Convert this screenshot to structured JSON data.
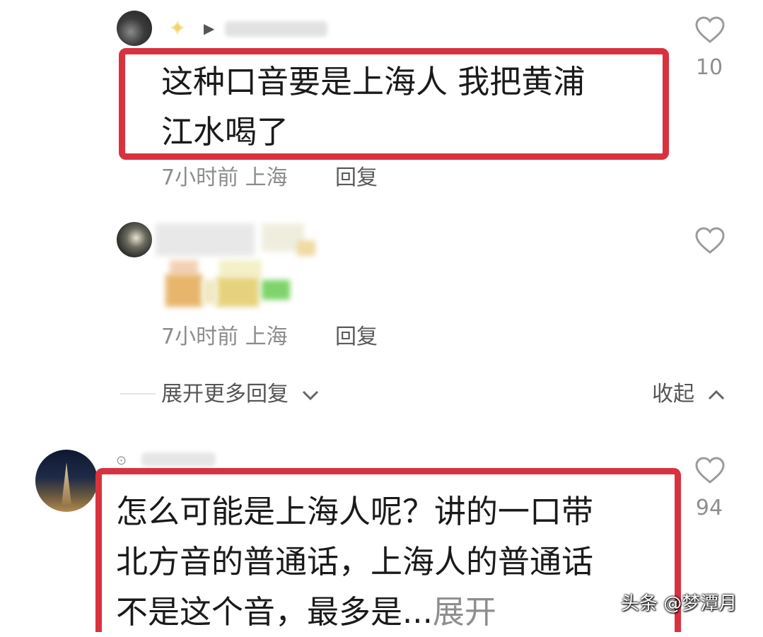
{
  "comments": [
    {
      "text": "这种口音要是上海人 我把黄浦\n江水喝了",
      "time_location": "7小时前 上海",
      "reply_label": "回复",
      "like_count": "10"
    },
    {
      "time_location": "7小时前 上海",
      "reply_label": "回复"
    },
    {
      "text": "怎么可能是上海人呢？讲的一口带\n北方音的普通话，上海人的普通话\n不是这个音，最多是...",
      "expand_label": "展开",
      "like_count": "94"
    }
  ],
  "thread": {
    "expand_more_label": "展开更多回复",
    "collapse_label": "收起"
  },
  "watermark": "头条 @梦潭月",
  "colors": {
    "highlight_box": "#d8323f",
    "meta_text": "#8c8c8c",
    "expand_text": "#8e8e8e"
  },
  "icons": {
    "like": "heart-outline-icon",
    "expand": "chevron-down-icon",
    "collapse": "chevron-up-icon",
    "badge": "star-badge-icon",
    "pin": "location-pin-icon"
  }
}
